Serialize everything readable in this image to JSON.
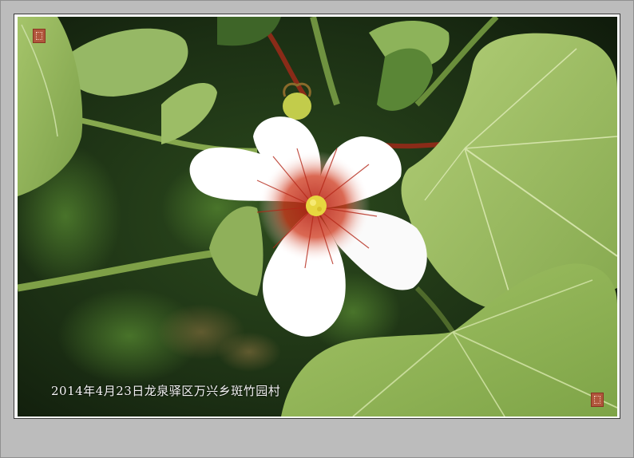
{
  "photo": {
    "caption": "2014年4月23日龙泉驿区万兴乡斑竹园村",
    "subject": "white flower with red-streaked center among heart-shaped green leaves",
    "colors": {
      "background": "#1b2b14",
      "leaf_light": "#a9c66d",
      "leaf_mid": "#8fb25a",
      "petal": "#ffffff",
      "center_red": "#c0301c",
      "stamen": "#e8d23c",
      "mat_gray": "#bcbcbc"
    }
  },
  "seals": [
    "seal-top-left",
    "seal-bottom-right"
  ]
}
